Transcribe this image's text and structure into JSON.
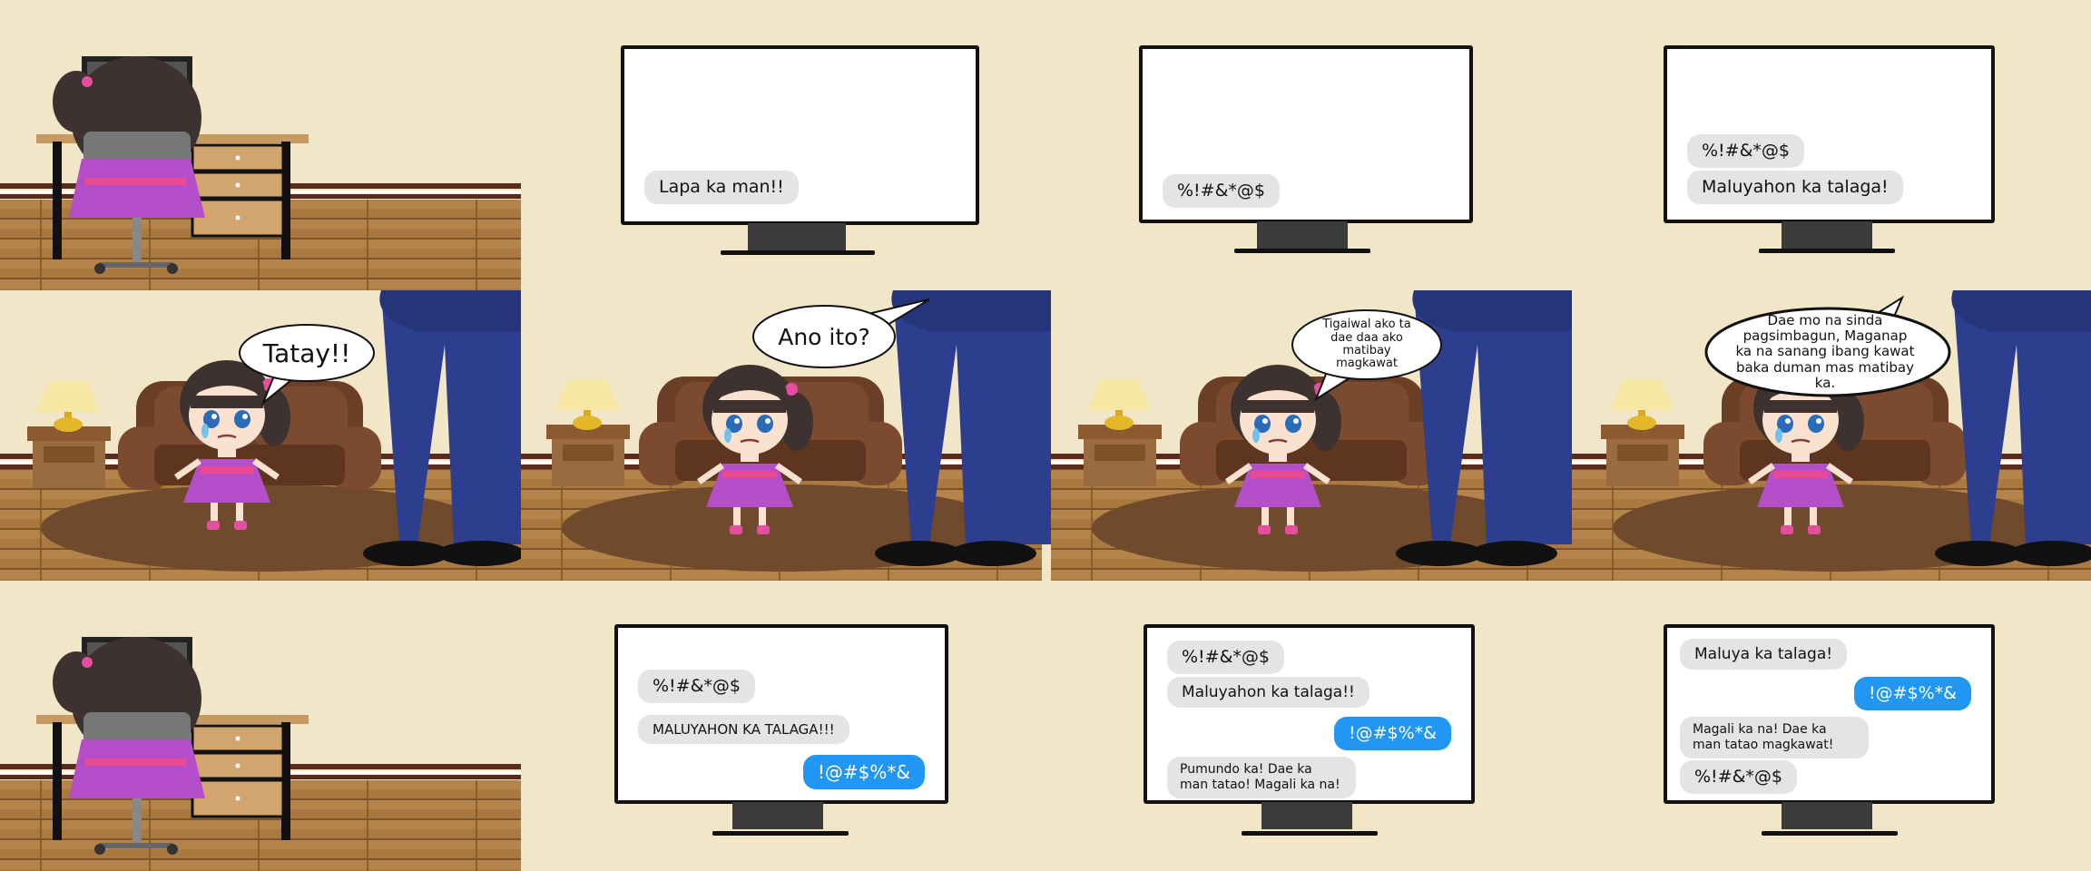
{
  "colors": {
    "wall": "#f2e6c9",
    "floor": "#a77a45",
    "screen_border": "#111111",
    "bubble_in": "#e4e4e6",
    "bubble_out": "#2196f3"
  },
  "speech": {
    "p2": "Tatay!!",
    "p3": "Ano ito?",
    "p4": "Tigaiwal ako ta dae daa ako matibay magkawat",
    "p5": "Dae mo na sinda pagsimbagun, Maganap ka na sanang ibang kawat baka duman mas matibay ka."
  },
  "screens": {
    "r1c2": [
      {
        "text": "Lapa ka man!!",
        "side": "in"
      }
    ],
    "r1c3": [
      {
        "text": "%!#&*@$",
        "side": "in"
      }
    ],
    "r1c4": [
      {
        "text": "%!#&*@$",
        "side": "in"
      },
      {
        "text": "Maluyahon ka talaga!",
        "side": "in"
      }
    ],
    "r3c2": [
      {
        "text": "%!#&*@$",
        "side": "in"
      },
      {
        "text": "MALUYAHON KA TALAGA!!!",
        "side": "in"
      },
      {
        "text": "!@#$%*&",
        "side": "out"
      }
    ],
    "r3c3": [
      {
        "text": "%!#&*@$",
        "side": "in"
      },
      {
        "text": "Maluyahon ka talaga!!",
        "side": "in"
      },
      {
        "text": "!@#$%*&",
        "side": "out"
      },
      {
        "text": "Pumundo ka! Dae ka man tatao! Magali ka na!",
        "side": "in"
      }
    ],
    "r3c4": [
      {
        "text": "Maluya ka talaga!",
        "side": "in"
      },
      {
        "text": "!@#$%*&",
        "side": "out"
      },
      {
        "text": "Magali ka na! Dae ka man tatao magkawat!",
        "side": "in"
      },
      {
        "text": "%!#&*@$",
        "side": "in"
      }
    ]
  }
}
